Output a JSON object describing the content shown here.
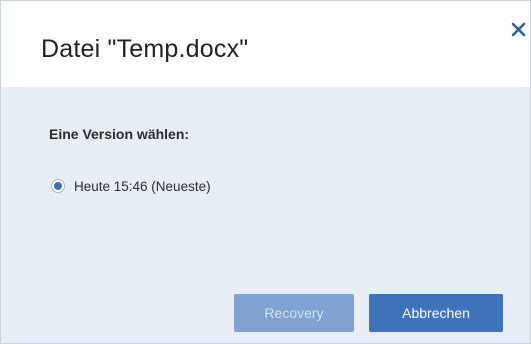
{
  "dialog": {
    "title": "Datei \"Temp.docx\"",
    "close_icon": "close-icon",
    "section_label": "Eine Version wählen:",
    "options": [
      {
        "label": "Heute 15:46 (Neueste)",
        "selected": true
      }
    ],
    "buttons": {
      "recovery_label": "Recovery",
      "recovery_disabled": true,
      "cancel_label": "Abbrechen"
    }
  },
  "colors": {
    "accent": "#3e73bc",
    "accent_disabled": "#7fa2d3",
    "body_bg": "#e8eef6",
    "close_icon": "#2f5f9e"
  }
}
